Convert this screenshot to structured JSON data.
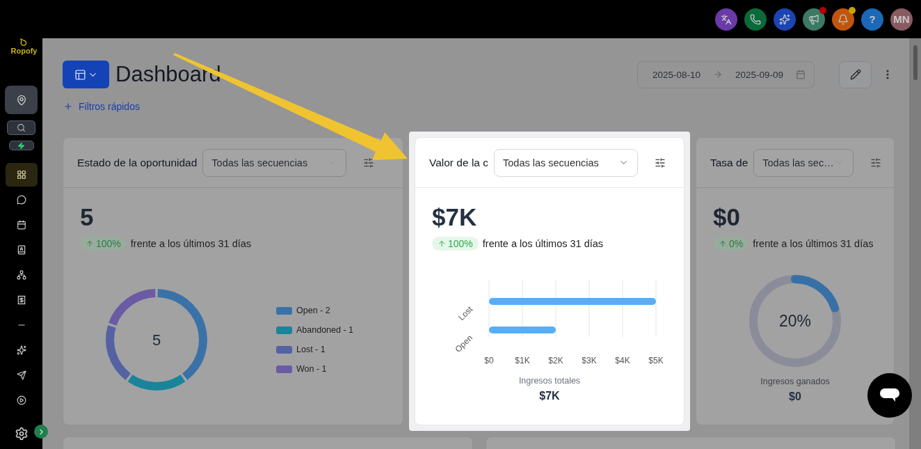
{
  "top_bar": {
    "actions": [
      {
        "kind": "icon"
      },
      {
        "kind": "icon"
      },
      {
        "kind": "icon"
      },
      {
        "kind": "icon",
        "badge": {
          "color": "#b80000"
        }
      },
      {
        "kind": "icon",
        "badge": {
          "color": "#c9a400"
        }
      },
      {
        "kind": "help",
        "label": "?"
      },
      {
        "kind": "avatar",
        "initials": "MN"
      }
    ]
  },
  "sidebar": {
    "logo": "Ropofy",
    "nav": [
      {
        "selected": true
      },
      {
        "selected": false
      },
      {
        "selected": false
      },
      {
        "selected": false
      },
      {
        "selected": false
      },
      {
        "selected": false
      },
      {
        "selected": false
      },
      {
        "selected": false
      },
      {
        "selected": false
      },
      {
        "selected": false
      }
    ]
  },
  "header": {
    "title": "Dashboard",
    "quick_filters": "Filtros rápidos",
    "date_range": {
      "start": "2025-08-10",
      "end": "2025-09-09"
    }
  },
  "cards": [
    {
      "kind": "donut",
      "highlighted": false,
      "title": "Estado de la oportunidad",
      "select": "Todas las secuencias",
      "metric": "5",
      "change": "100%",
      "comparison": "frente a los últimos 31 días",
      "center": "5",
      "legend": [
        {
          "color": "#3a72a8"
        },
        {
          "color": "#19849a"
        },
        {
          "color": "#5462a4"
        },
        {
          "color": "#6b5aa4"
        }
      ],
      "chart_data": {
        "type": "donut",
        "categories": [
          "Open - 2",
          "Abandoned - 1",
          "Lost - 1",
          "Won - 1"
        ],
        "values": [
          40,
          20,
          20,
          20
        ]
      }
    },
    {
      "kind": "bar",
      "highlighted": true,
      "title": "Valor de la c",
      "select": "Todas las secuencias",
      "metric": "$7K",
      "change": "100%",
      "comparison": "frente a los últimos 31 días",
      "summary_label": "Ingresos totales",
      "summary_value": "$7K",
      "chart_data": {
        "type": "bar",
        "orientation": "horizontal",
        "grid": true,
        "categories": [
          "Lost",
          "Open"
        ],
        "values": [
          5000,
          2000
        ],
        "xlim": [
          0,
          5000
        ],
        "xticks": [
          {
            "value": 0,
            "label": "$0"
          },
          {
            "value": 1000,
            "label": "$1K"
          },
          {
            "value": 2000,
            "label": "$2K"
          },
          {
            "value": 3000,
            "label": "$3K"
          },
          {
            "value": 4000,
            "label": "$4K"
          },
          {
            "value": 5000,
            "label": "$5K"
          }
        ]
      }
    },
    {
      "kind": "gauge",
      "highlighted": false,
      "title": "Tasa de",
      "select": "Todas las sec…",
      "metric": "$0",
      "change": "0%",
      "comparison": "frente a los últimos 31 días",
      "gauge": {
        "level": 0.2,
        "reading": "20%"
      },
      "summary_label": "Ingresos ganados",
      "summary_value": "$0"
    }
  ]
}
